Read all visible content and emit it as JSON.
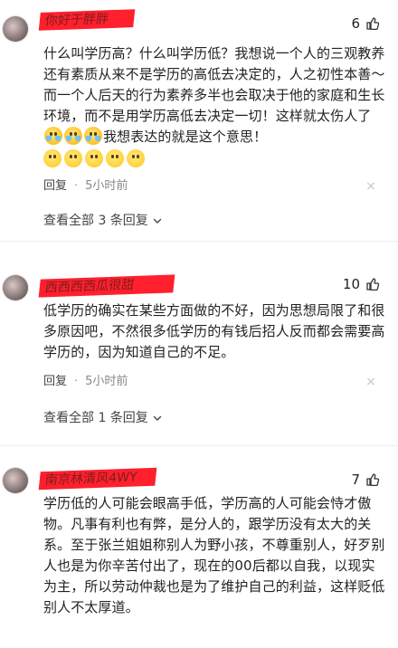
{
  "comments": [
    {
      "username": "你好于胖胖",
      "likes": "6",
      "text_before": "什么叫学历高？什么叫学历低？我想说一个人的三观教养还有素质从来不是学历的高低去决定的，人之初性本善～而一个人后天的行为素养多半也会取决于他的家庭和生长环境，而不是用学历高低去决定一切！这样就太伤人了",
      "text_after": "我想表达的就是这个意思！",
      "inline_emojis": [
        "crying-laughing",
        "crying-laughing",
        "crying-laughing"
      ],
      "trailing_emojis": [
        "sad-smile",
        "sad-smile",
        "sad-smile",
        "sad-smile",
        "sad-smile"
      ],
      "reply_label": "回复",
      "time": "5小时前",
      "view_replies": "查看全部 3 条回复"
    },
    {
      "username": "西西西西瓜很甜",
      "likes": "10",
      "text": "低学历的确实在某些方面做的不好，因为思想局限了和很多原因吧，不然很多低学历的有钱后招人反而都会需要高学历的，因为知道自己的不足。",
      "reply_label": "回复",
      "time": "5小时前",
      "view_replies": "查看全部 1 条回复"
    },
    {
      "username": "南京林清风4WY",
      "likes": "7",
      "text": "学历低的人可能会眼高手低，学历高的人可能会恃才傲物。凡事有利也有弊，是分人的，跟学历没有太大的关系。至于张兰姐姐称别人为野小孩，不尊重别人，好歹别人也是为你辛苦付出了，现在的00后都以自我，以现实为主，所以劳动仲裁也是为了维护自己的利益，这样贬低别人不太厚道。"
    }
  ],
  "colors": {
    "name_highlight": "#ff1f2d",
    "text": "#222222",
    "meta": "#888888"
  },
  "icons": {
    "like": "thumbs-up-icon",
    "close": "close-icon",
    "expand": "chevron-down-icon"
  }
}
